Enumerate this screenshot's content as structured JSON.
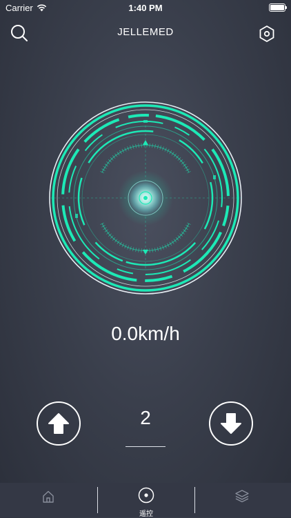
{
  "status_bar": {
    "carrier": "Carrier",
    "time": "1:40 PM"
  },
  "nav": {
    "title": "JELLEMED"
  },
  "speed": {
    "display": "0.0km/h"
  },
  "gear": {
    "value": "2"
  },
  "tabs": [
    {
      "id": "home",
      "icon": "home-icon",
      "label": ""
    },
    {
      "id": "remote",
      "icon": "remote-control-icon",
      "label": "遥控",
      "active": true
    },
    {
      "id": "layers",
      "icon": "layers-icon",
      "label": ""
    }
  ],
  "colors": {
    "accent": "#1de9b6",
    "background": "#3a3f4c",
    "tab_bar": "#343845"
  }
}
